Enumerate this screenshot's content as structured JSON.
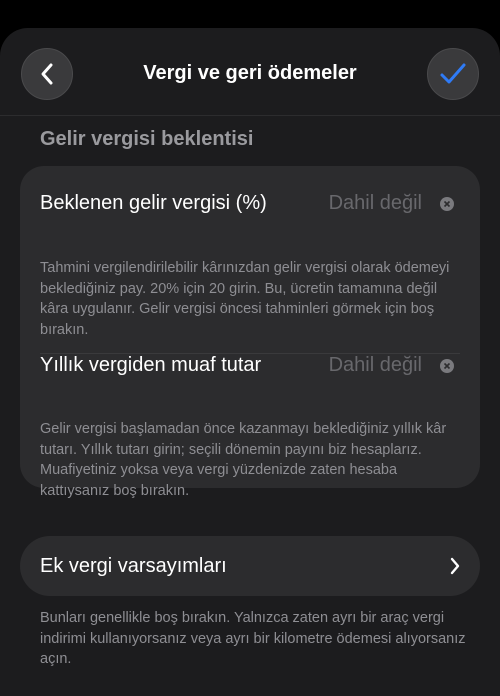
{
  "header": {
    "title": "Vergi ve geri ödemeler",
    "back_icon": "chevron-left-icon",
    "confirm_icon": "checkmark-icon",
    "accent_color": "#2f7bf6"
  },
  "section": {
    "label": "Gelir vergisi beklentisi"
  },
  "fields": [
    {
      "title": "Beklenen gelir vergisi (%)",
      "value": "Dahil değil",
      "description": "Tahmini vergilendirilebilir kârınızdan gelir vergisi olarak ödemeyi beklediğiniz pay. 20% için 20 girin. Bu, ücretin tamamına değil kâra uygulanır. Gelir vergisi öncesi tahminleri görmek için boş bırakın."
    },
    {
      "title": "Yıllık vergiden muaf tutar",
      "value": "Dahil değil",
      "description": "Gelir vergisi başlamadan önce kazanmayı beklediğiniz yıllık kâr tutarı. Yıllık tutarı girin; seçili dönemin payını biz hesaplarız. Muafiyetiniz yoksa veya vergi yüzdenizde zaten hesaba kattıysanız boş bırakın."
    }
  ],
  "extra": {
    "label": "Ek vergi varsayımları",
    "note": "Bunları genellikle boş bırakın. Yalnızca zaten ayrı bir araç vergi indirimi kullanıyorsanız veya ayrı bir kilometre ödemesi alıyorsanız açın."
  }
}
